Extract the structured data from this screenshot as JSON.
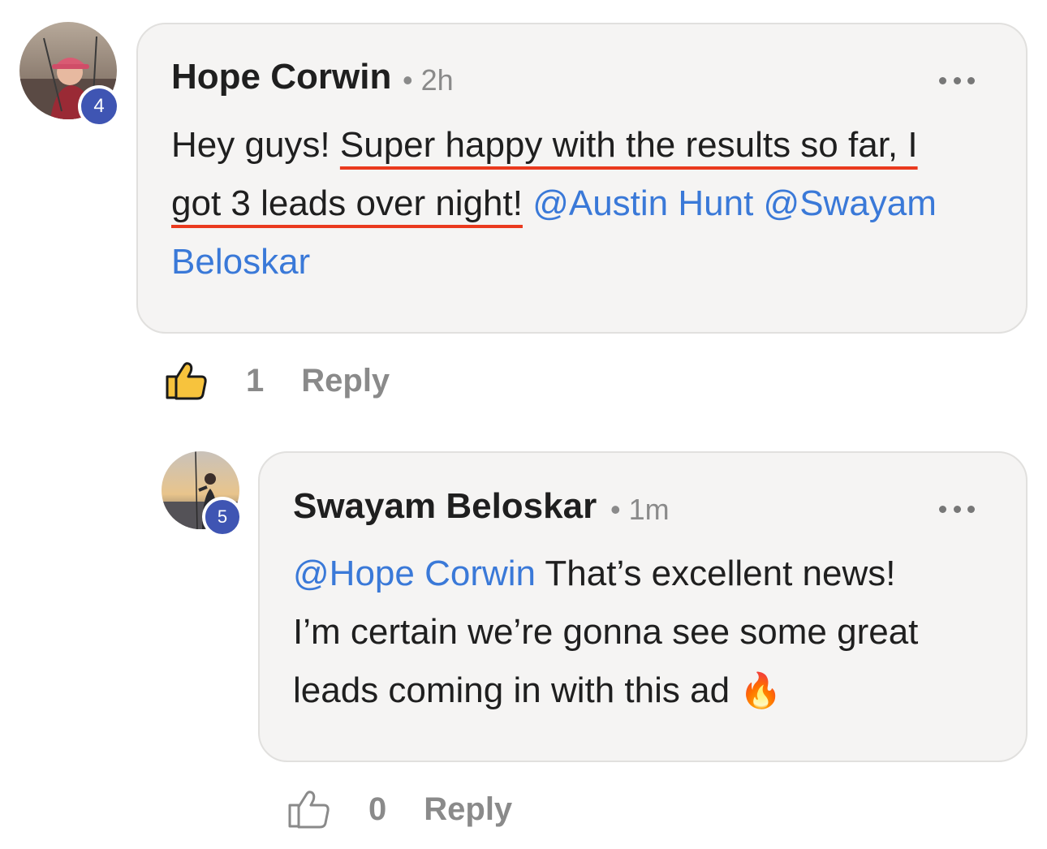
{
  "comments": [
    {
      "author": "Hope Corwin",
      "time": "• 2h",
      "badge": "4",
      "text_plain_1": "Hey guys! ",
      "text_underlined_1": "Super happy with the results so far, I",
      "text_underlined_2": "got 3 leads over night!",
      "mention_1": "@Austin Hunt",
      "mention_2": "@Swayam",
      "mention_2b": "Beloskar",
      "likes": "1",
      "reply_label": "Reply",
      "like_icon": "thumbs-up-icon-filled",
      "more_icon": "ellipsis-icon"
    },
    {
      "author": "Swayam Beloskar",
      "time": "• 1m",
      "badge": "5",
      "mention": "@Hope Corwin",
      "text_1": " That’s excellent news!",
      "text_2": "I’m certain we’re gonna see some great",
      "text_3": "leads coming in with this ad ",
      "emoji": "🔥",
      "likes": "0",
      "reply_label": "Reply",
      "like_icon": "thumbs-up-icon-outline",
      "more_icon": "ellipsis-icon"
    }
  ],
  "colors": {
    "mention": "#3a79d8",
    "underline": "#ea3a1e",
    "badge": "#3f55b3",
    "like_filled": "#f7c33d"
  }
}
